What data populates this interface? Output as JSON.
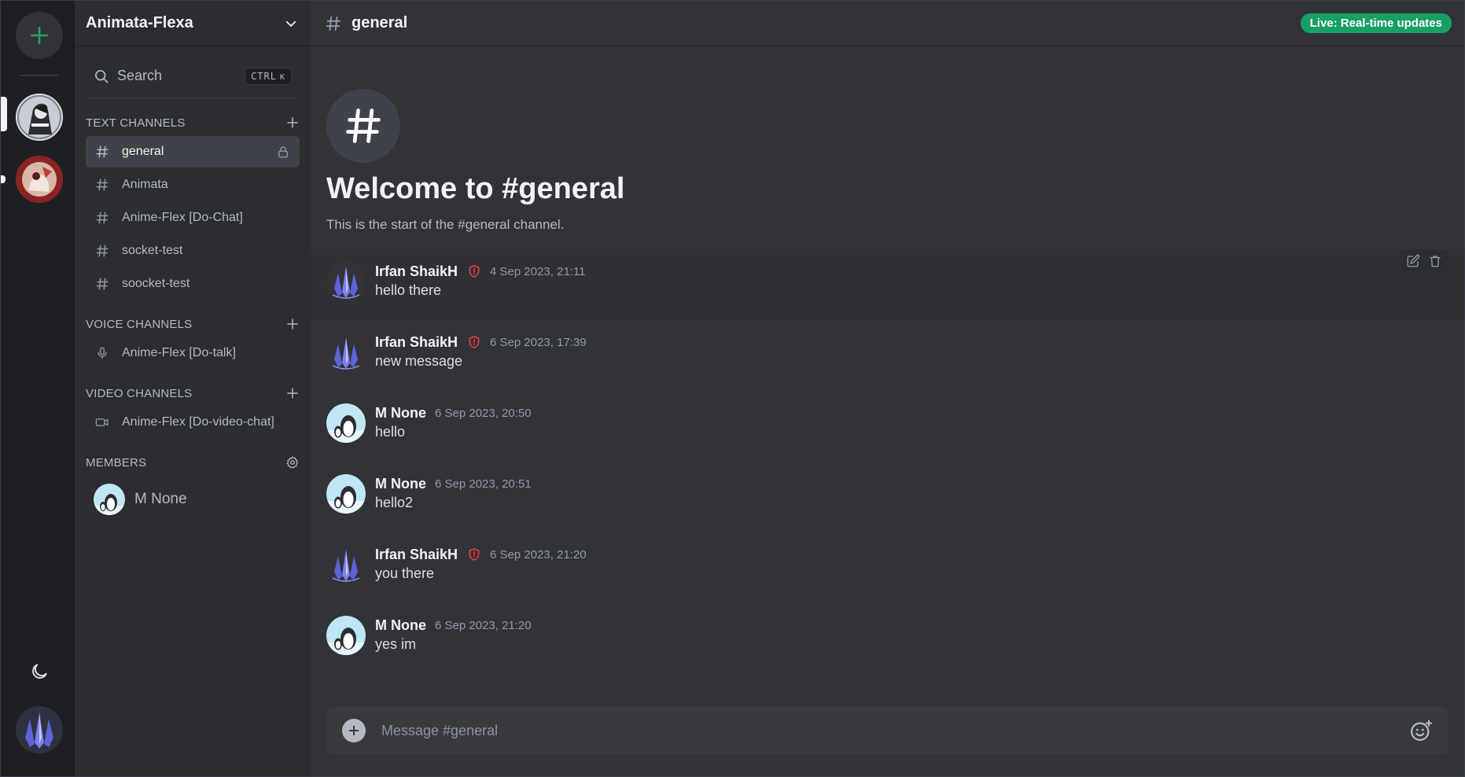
{
  "server": {
    "name": "Animata-Flexa"
  },
  "search": {
    "label": "Search",
    "shortcut_key": "CTRL",
    "shortcut_letter": "K"
  },
  "sections": {
    "text": "TEXT CHANNELS",
    "voice": "VOICE CHANNELS",
    "video": "VIDEO CHANNELS",
    "members": "MEMBERS"
  },
  "text_channels": [
    {
      "label": "general",
      "icon": "hash-icon",
      "active": true,
      "locked": true
    },
    {
      "label": "Animata",
      "icon": "hash-icon"
    },
    {
      "label": "Anime-Flex [Do-Chat]",
      "icon": "hash-icon"
    },
    {
      "label": "socket-test",
      "icon": "hash-icon"
    },
    {
      "label": "soocket-test",
      "icon": "hash-icon"
    }
  ],
  "voice_channels": [
    {
      "label": "Anime-Flex [Do-talk]",
      "icon": "microphone-icon"
    }
  ],
  "video_channels": [
    {
      "label": "Anime-Flex [Do-video-chat]",
      "icon": "video-icon"
    }
  ],
  "members": [
    {
      "name": "M None"
    }
  ],
  "topbar": {
    "channel": "general",
    "live_badge": "Live: Real-time updates"
  },
  "welcome": {
    "title": "Welcome to #general",
    "subtitle": "This is the start of the #general channel."
  },
  "messages": [
    {
      "author": "Irfan ShaikH",
      "time": "4 Sep 2023, 21:11",
      "text": "hello there",
      "moderator": true,
      "avatar": "crystal"
    },
    {
      "author": "Irfan ShaikH",
      "time": "6 Sep 2023, 17:39",
      "text": "new message",
      "moderator": true,
      "avatar": "crystal"
    },
    {
      "author": "M None",
      "time": "6 Sep 2023, 20:50",
      "text": "hello",
      "moderator": false,
      "avatar": "penguin"
    },
    {
      "author": "M None",
      "time": "6 Sep 2023, 20:51",
      "text": "hello2",
      "moderator": false,
      "avatar": "penguin"
    },
    {
      "author": "Irfan ShaikH",
      "time": "6 Sep 2023, 21:20",
      "text": "you there",
      "moderator": true,
      "avatar": "crystal"
    },
    {
      "author": "M None",
      "time": "6 Sep 2023, 21:20",
      "text": "yes im",
      "moderator": false,
      "avatar": "penguin"
    }
  ],
  "composer": {
    "placeholder": "Message #general"
  },
  "colors": {
    "accent_green": "#23a55a",
    "live_badge": "#16a064",
    "moderator_shield": "#f23f43"
  }
}
